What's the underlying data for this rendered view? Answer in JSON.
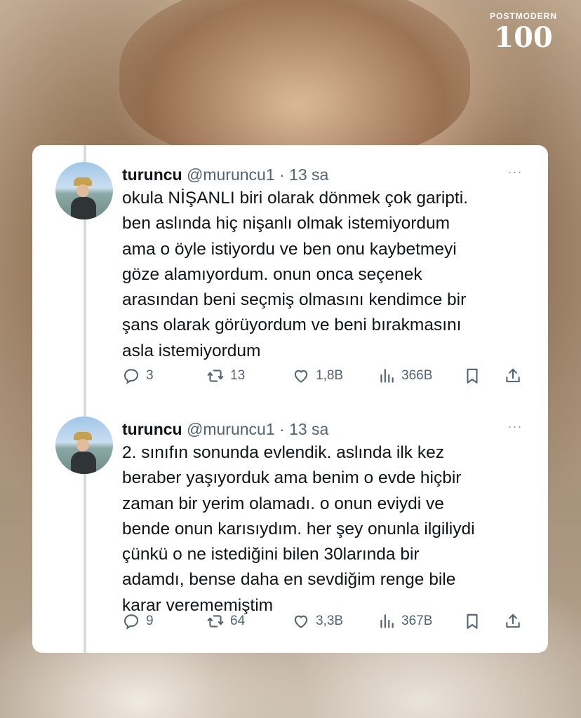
{
  "brand": {
    "top_text": "POSTMODERN",
    "number_text": "100"
  },
  "tweets": [
    {
      "name": "turuncu",
      "handle": "@muruncu1",
      "separator": "·",
      "time": "13 sa",
      "more": "···",
      "text": "okula NİŞANLI biri olarak dönmek çok garipti.\nben aslında hiç nişanlı olmak istemiyordum\nama o öyle istiyordu ve ben onu kaybetmeyi\ngöze alamıyordum. onun onca seçenek\narasından beni seçmiş olmasını kendimce bir\nşans olarak görüyordum ve beni bırakmasını\nasla istemiyordum",
      "replies": "3",
      "retweets": "13",
      "likes": "1,8B",
      "views": "366B"
    },
    {
      "name": "turuncu",
      "handle": "@muruncu1",
      "separator": "·",
      "time": "13 sa",
      "more": "···",
      "text": "2. sınıfın sonunda evlendik. aslında ilk kez\nberaber yaşıyorduk ama benim o evde hiçbir\nzaman bir yerim olamadı. o onun eviydi ve\nbende onun karısıydım. her şey onunla ilgiliydi\nçünkü o ne istediğini bilen 30larında bir\nadamdı, bense daha en sevdiğim renge bile\nkarar verememiştim",
      "replies": "9",
      "retweets": "64",
      "likes": "3,3B",
      "views": "367B"
    }
  ],
  "colors": {
    "text_primary": "#0f1419",
    "text_secondary": "#536471",
    "card_background": "#ffffff",
    "thread_line": "#d6dbdf"
  },
  "icons": [
    "reply-icon",
    "retweet-icon",
    "like-icon",
    "views-icon",
    "bookmark-icon",
    "share-icon",
    "more-icon"
  ]
}
